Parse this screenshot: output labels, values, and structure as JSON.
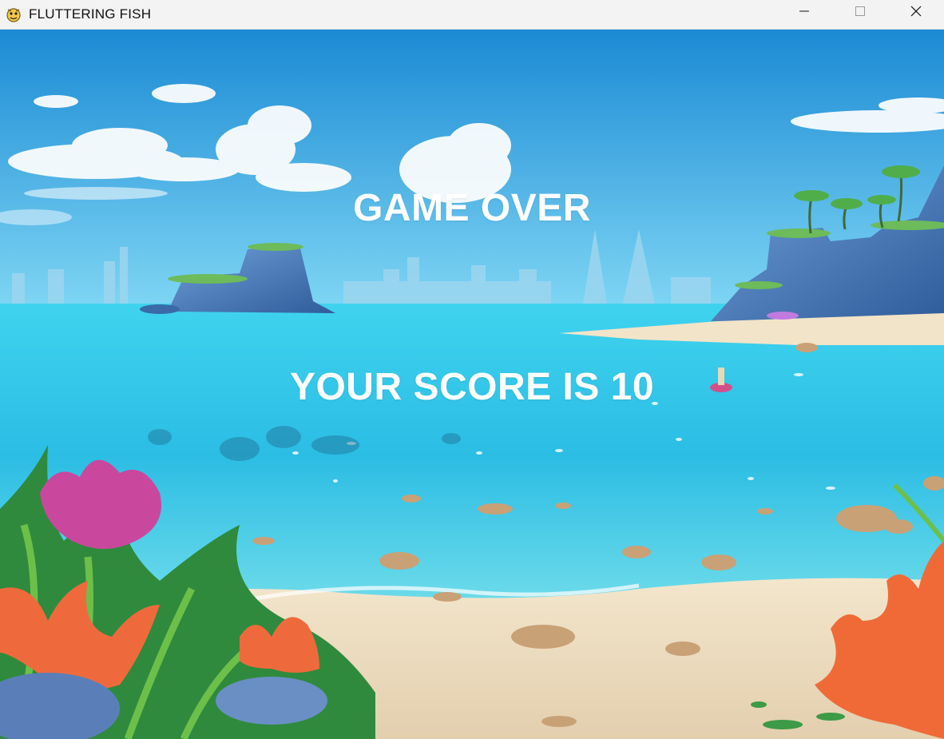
{
  "window": {
    "title": "FLUTTERING FISH",
    "icon": "pygame-snake-icon",
    "controls": [
      "minimize-icon",
      "maximize-icon",
      "close-icon"
    ]
  },
  "game": {
    "game_over_text": "GAME OVER",
    "score_text": "YOUR SCORE IS 10",
    "score": 10
  },
  "colors": {
    "sky_top": "#1f8fd6",
    "sky_bottom": "#6fd0f3",
    "sea": "#2fc3e8",
    "sand": "#ecdcc0",
    "text": "#ffffff"
  }
}
